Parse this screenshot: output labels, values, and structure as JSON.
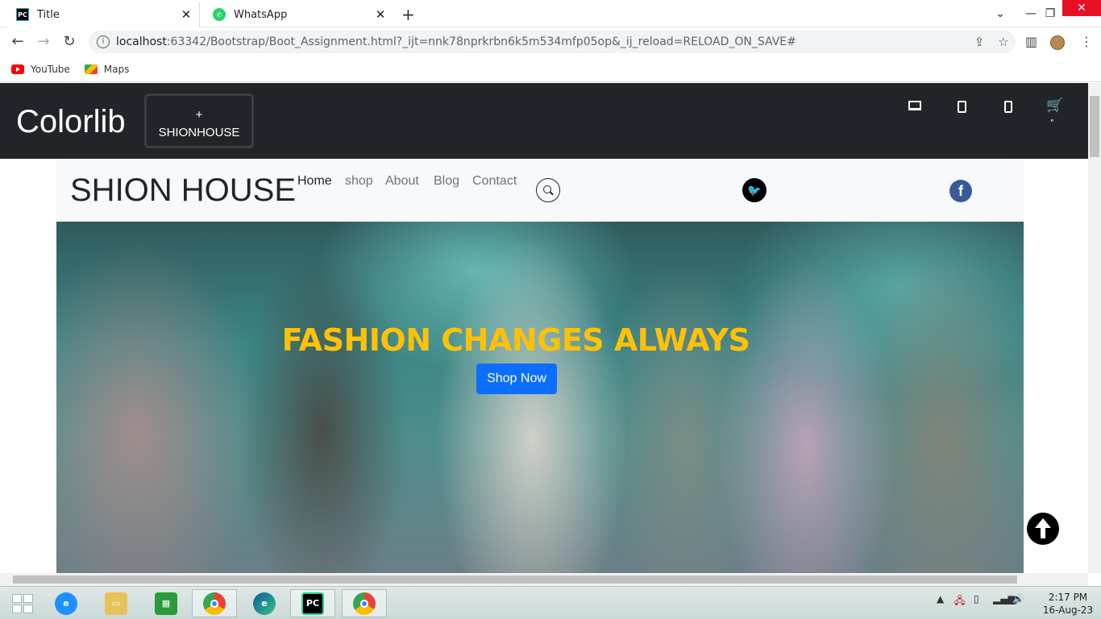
{
  "browser": {
    "tabs": [
      {
        "title": "Title",
        "icon": "pycharm-icon"
      },
      {
        "title": "WhatsApp",
        "icon": "whatsapp-icon"
      }
    ],
    "url_host": "localhost",
    "url_rest": ":63342/Bootstrap/Boot_Assignment.html?_ijt=nnk78nprkrbn6k5m534mfp05op&_ij_reload=RELOAD_ON_SAVE#",
    "bookmarks": [
      {
        "label": "YouTube",
        "icon": "youtube-icon"
      },
      {
        "label": "Maps",
        "icon": "maps-icon"
      }
    ]
  },
  "page": {
    "topnav": {
      "brand": "Colorlib",
      "brandbox_plus": "+",
      "brandbox_text": "SHIONHOUSE",
      "icons": [
        "laptop-icon",
        "tablet-icon",
        "phone-icon",
        "cart-icon"
      ],
      "cart_count": "\""
    },
    "subnav": {
      "title": "SHION HOUSE",
      "menu": [
        "Home",
        "shop",
        "About",
        "Blog",
        "Contact"
      ],
      "active": "Home"
    },
    "hero": {
      "title": "FASHION CHANGES ALWAYS",
      "button": "Shop Now",
      "title_color": "#ffc107",
      "button_color": "#0d6efd"
    }
  },
  "taskbar": {
    "apps": [
      "internet-explorer-icon",
      "file-explorer-icon",
      "store-icon",
      "chrome-icon",
      "edge-icon",
      "pycharm-icon",
      "chrome-profile-icon"
    ],
    "time": "2:17 PM",
    "date": "16-Aug-23"
  }
}
